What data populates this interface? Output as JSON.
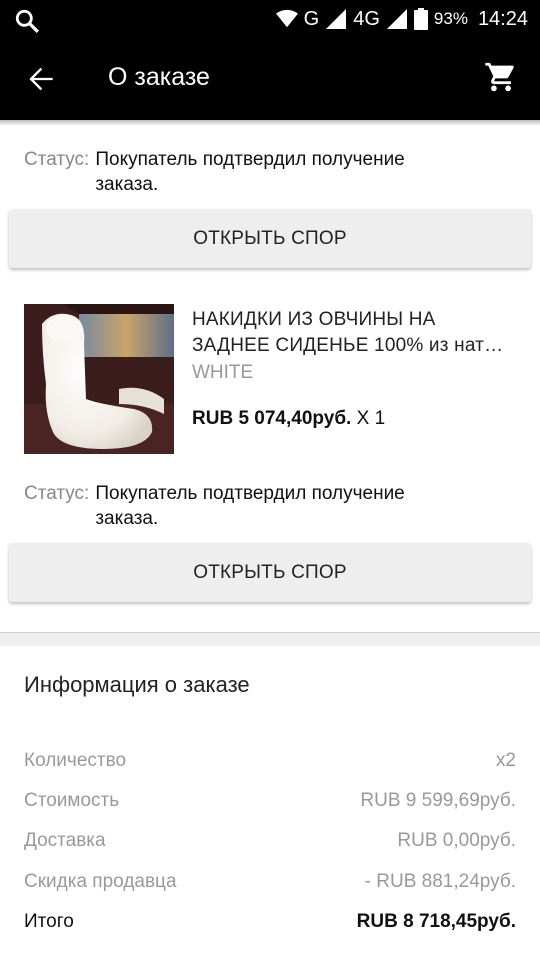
{
  "status_bar": {
    "network": "G",
    "network2": "4G",
    "battery": "93%",
    "time": "14:24"
  },
  "app_bar": {
    "title": "О заказе"
  },
  "order_items": [
    {
      "status_label": "Статус:",
      "status_value": "Покупатель подтвердил получение заказа.",
      "dispute_label": "ОТКРЫТЬ СПОР"
    },
    {
      "name_line1": "НАКИДКИ ИЗ ОВЧИНЫ НА",
      "name_line2": "ЗАДНЕЕ СИДЕНЬЕ 100%  из нат…",
      "color": "WHITE",
      "price": "RUB 5 074,40руб.",
      "qty": "X 1",
      "status_label": "Статус:",
      "status_value": "Покупатель подтвердил получение заказа.",
      "dispute_label": "ОТКРЫТЬ СПОР"
    }
  ],
  "order_info": {
    "title": "Информация о заказе",
    "rows": [
      {
        "label": "Количество",
        "value": "x2"
      },
      {
        "label": "Стоимость",
        "value": "RUB 9 599,69руб."
      },
      {
        "label": "Доставка",
        "value": "RUB 0,00руб."
      },
      {
        "label": "Скидка продавца",
        "value": "- RUB 881,24руб."
      },
      {
        "label": "Итого",
        "value": "RUB 8 718,45руб."
      }
    ]
  },
  "colors": {
    "bar_bg": "#000000",
    "button_bg": "#eeeeee",
    "muted_text": "#999999"
  }
}
